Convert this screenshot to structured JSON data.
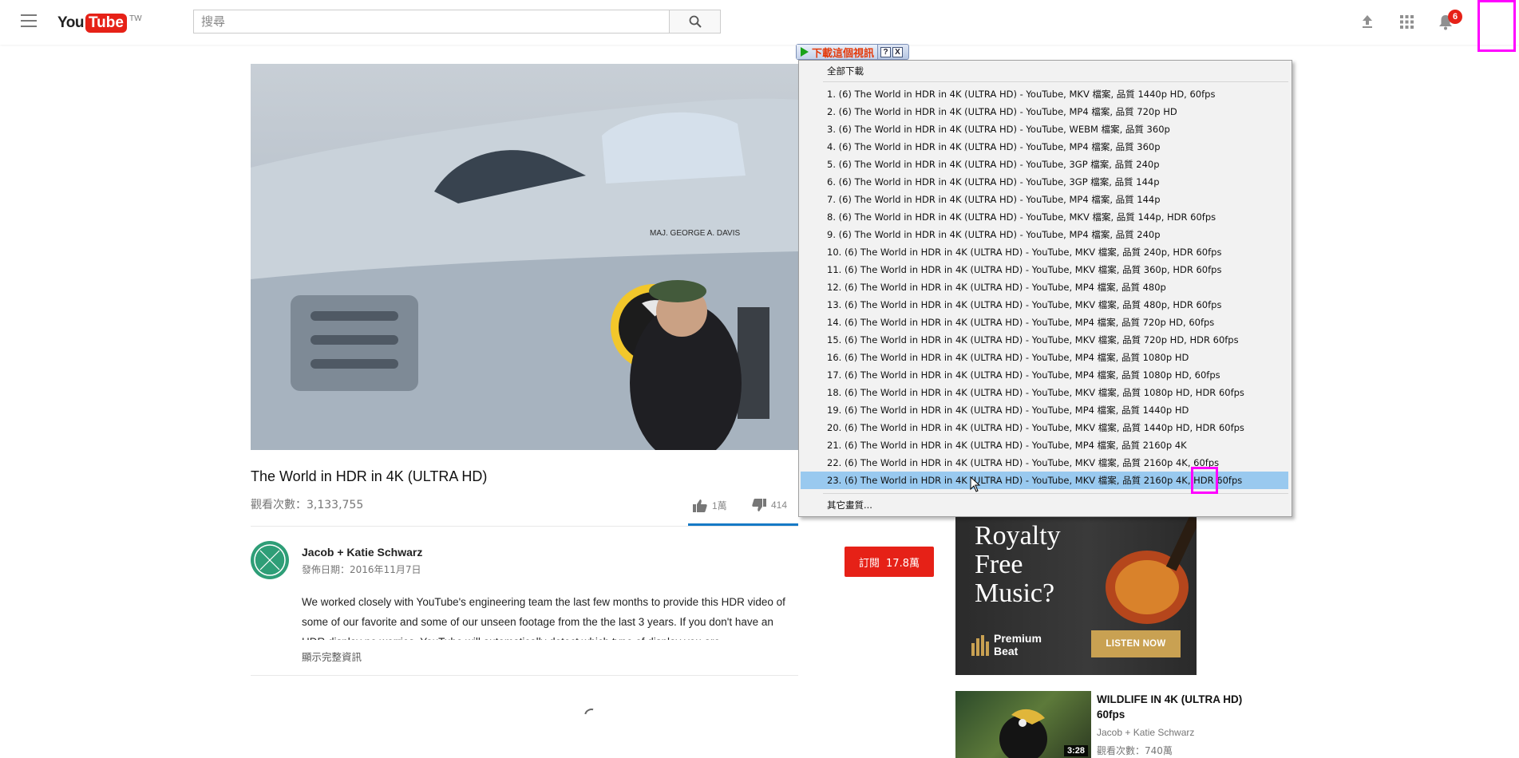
{
  "header": {
    "logo_you": "You",
    "logo_tube": "Tube",
    "logo_region": "TW",
    "search_placeholder": "搜尋",
    "notifications_count": "6"
  },
  "video": {
    "title": "The World in HDR in 4K (ULTRA HD)",
    "views_label": "觀看次數：",
    "views_value": "3,133,755",
    "likes": "1萬",
    "dislikes": "414",
    "channel": "Jacob + Katie Schwarz",
    "published_label": "發佈日期：",
    "published_date": "2016年11月7日",
    "subscribe_label": "訂閱",
    "subscriber_count": "17.8萬",
    "description": "We worked closely with YouTube's engineering team the last few months to provide this HDR video of some of our favorite and some of our unseen footage from the the last 3 years. If you don't have an HDR display no worries. YouTube will automatically detect which type of display you are",
    "show_more": "顯示完整資訊",
    "overlay_plane_text": "MAJ. GEORGE A. DAVIS"
  },
  "ad": {
    "headline_line1": "Royalty",
    "headline_line2": "Free",
    "headline_line3": "Music?",
    "brand_line1": "Premium",
    "brand_line2": "Beat",
    "cta": "LISTEN NOW"
  },
  "related": {
    "title": "WILDLIFE IN 4K (ULTRA HD) 60fps",
    "duration": "3:28",
    "channel": "Jacob + Katie Schwarz",
    "views": "觀看次數：740萬"
  },
  "downloader": {
    "toolbar_label": "下載這個視訊",
    "help": "?",
    "close": "X",
    "download_all": "全部下載",
    "other_quality": "其它畫質...",
    "selected_index": 23,
    "items": [
      "1.  (6) The World in HDR in 4K (ULTRA HD) - YouTube,  MKV 檔案, 品質 1440p HD, 60fps",
      "2.  (6) The World in HDR in 4K (ULTRA HD) - YouTube,  MP4 檔案, 品質 720p HD",
      "3.  (6) The World in HDR in 4K (ULTRA HD) - YouTube,  WEBM 檔案, 品質 360p",
      "4.  (6) The World in HDR in 4K (ULTRA HD) - YouTube,  MP4 檔案, 品質 360p",
      "5.  (6) The World in HDR in 4K (ULTRA HD) - YouTube,  3GP 檔案, 品質 240p",
      "6.  (6) The World in HDR in 4K (ULTRA HD) - YouTube,  3GP 檔案, 品質 144p",
      "7.  (6) The World in HDR in 4K (ULTRA HD) - YouTube,  MP4 檔案, 品質 144p",
      "8.  (6) The World in HDR in 4K (ULTRA HD) - YouTube,  MKV 檔案, 品質 144p, HDR 60fps",
      "9.  (6) The World in HDR in 4K (ULTRA HD) - YouTube,  MP4 檔案, 品質 240p",
      "10.  (6) The World in HDR in 4K (ULTRA HD) - YouTube,  MKV 檔案, 品質 240p, HDR 60fps",
      "11.  (6) The World in HDR in 4K (ULTRA HD) - YouTube,  MKV 檔案, 品質 360p, HDR 60fps",
      "12.  (6) The World in HDR in 4K (ULTRA HD) - YouTube,  MP4 檔案, 品質 480p",
      "13.  (6) The World in HDR in 4K (ULTRA HD) - YouTube,  MKV 檔案, 品質 480p, HDR 60fps",
      "14.  (6) The World in HDR in 4K (ULTRA HD) - YouTube,  MP4 檔案, 品質 720p HD, 60fps",
      "15.  (6) The World in HDR in 4K (ULTRA HD) - YouTube,  MKV 檔案, 品質 720p HD, HDR 60fps",
      "16.  (6) The World in HDR in 4K (ULTRA HD) - YouTube,  MP4 檔案, 品質 1080p HD",
      "17.  (6) The World in HDR in 4K (ULTRA HD) - YouTube,  MP4 檔案, 品質 1080p HD, 60fps",
      "18.  (6) The World in HDR in 4K (ULTRA HD) - YouTube,  MKV 檔案, 品質 1080p HD, HDR 60fps",
      "19.  (6) The World in HDR in 4K (ULTRA HD) - YouTube,  MP4 檔案, 品質 1440p HD",
      "20.  (6) The World in HDR in 4K (ULTRA HD) - YouTube,  MKV 檔案, 品質 1440p HD, HDR 60fps",
      "21.  (6) The World in HDR in 4K (ULTRA HD) - YouTube,  MP4 檔案, 品質 2160p 4K",
      "22.  (6) The World in HDR in 4K (ULTRA HD) - YouTube,  MKV 檔案, 品質 2160p 4K, 60fps",
      "23.  (6) The World in HDR in 4K (ULTRA HD) - YouTube,  MKV 檔案, 品質 2160p 4K, HDR 60fps"
    ]
  },
  "colors": {
    "brand_red": "#e62117",
    "selection": "#99c9ef",
    "highlight_box": "#ff00ff",
    "progress_blue": "#167ac6"
  },
  "icons": [
    "menu-icon",
    "search-icon",
    "upload-icon",
    "apps-icon",
    "bell-icon",
    "thumbs-up-icon",
    "thumbs-down-icon",
    "play-icon",
    "mouse-cursor-icon"
  ]
}
